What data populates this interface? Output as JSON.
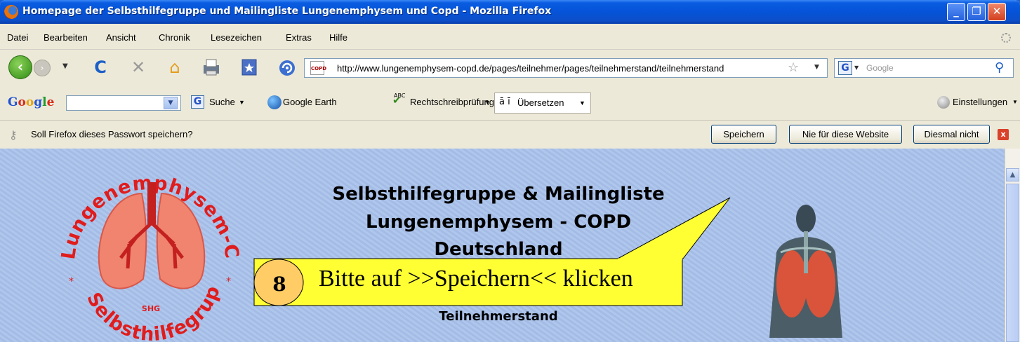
{
  "window": {
    "title": "Homepage der Selbsthilfegruppe und Mailingliste Lungenemphysem und Copd - Mozilla Firefox",
    "min_symbol": "_",
    "max_symbol": "❐",
    "close_symbol": "✕"
  },
  "menu": [
    "Datei",
    "Bearbeiten",
    "Ansicht",
    "Chronik",
    "Lesezeichen",
    "Extras",
    "Hilfe"
  ],
  "navbar": {
    "back_symbol": "‹",
    "forward_symbol": "›",
    "reload_symbol": "C",
    "stop_symbol": "✕",
    "home_symbol": "⌂",
    "url": "http://www.lungenemphysem-copd.de/pages/teilnehmer/pages/teilnehmerstand/teilnehmerstand",
    "site_icon_text": "COPD",
    "star_symbol": "☆",
    "search_engine_symbol": "G",
    "search_placeholder": "Google",
    "search_go_symbol": "⚲"
  },
  "google_toolbar": {
    "logo_letters": [
      {
        "ch": "G",
        "color": "#2152d3"
      },
      {
        "ch": "o",
        "color": "#d92a18"
      },
      {
        "ch": "o",
        "color": "#e8a312"
      },
      {
        "ch": "g",
        "color": "#2152d3"
      },
      {
        "ch": "l",
        "color": "#1e9a2e"
      },
      {
        "ch": "e",
        "color": "#d92a18"
      }
    ],
    "search_label": "Suche",
    "earth_label": "Google Earth",
    "spell_label": "Rechtschreibprüfung",
    "spell_icon_text": "ABC",
    "translate_label": "Übersetzen",
    "translate_icon_text": "ā ī",
    "settings_label": "Einstellungen"
  },
  "notification": {
    "text": "Soll Firefox dieses Passwort speichern?",
    "save_label": "Speichern",
    "never_label": "Nie für diese Website",
    "not_now_label": "Diesmal nicht",
    "close_symbol": "x"
  },
  "page": {
    "title_lines": [
      "Selbsthilfegruppe & Mailingliste",
      "Lungenemphysem - COPD",
      "Deutschland"
    ],
    "subtitle": "Teilnehmerstand",
    "logo_top_text": "Lungenemphysem-COPD",
    "logo_bottom_text": "Selbsthilfegruppe",
    "logo_center_text": "SHG"
  },
  "callout": {
    "step_number": "8",
    "text": "Bitte auf >>Speichern<< klicken",
    "fill_color": "#ffff33",
    "circle_color": "#ffcc66"
  }
}
